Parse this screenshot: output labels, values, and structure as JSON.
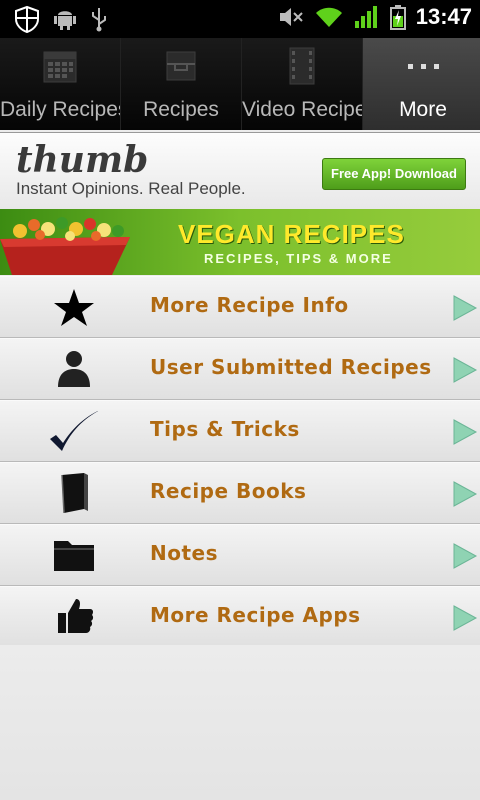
{
  "status_bar": {
    "time": "13:47",
    "icons": [
      "shield-icon",
      "android-icon",
      "usb-icon",
      "mute-icon",
      "wifi-icon",
      "signal-icon",
      "battery-charging-icon"
    ]
  },
  "tabs": [
    {
      "label": "Daily Recipes",
      "icon": "calendar-icon",
      "active": false
    },
    {
      "label": "Recipes",
      "icon": "recipe-box-icon",
      "active": false
    },
    {
      "label": "Video Recipe",
      "icon": "film-icon",
      "active": false
    },
    {
      "label": "More",
      "icon": "more-dots-icon",
      "active": true
    }
  ],
  "ad": {
    "logo": "thumb",
    "tagline": "Instant Opinions. Real People.",
    "button": "Free App! Download"
  },
  "banner": {
    "title": "VEGAN RECIPES",
    "subtitle": "RECIPES, TIPS & MORE"
  },
  "menu": [
    {
      "label": "More Recipe Info",
      "icon": "star-icon"
    },
    {
      "label": "User Submitted Recipes",
      "icon": "person-icon"
    },
    {
      "label": "Tips & Tricks",
      "icon": "checkmark-icon"
    },
    {
      "label": "Recipe Books",
      "icon": "book-icon"
    },
    {
      "label": "Notes",
      "icon": "folder-icon"
    },
    {
      "label": "More Recipe Apps",
      "icon": "thumbs-up-icon"
    }
  ],
  "colors": {
    "menu_text": "#b06a12",
    "arrow": "#8fd3b3",
    "active_tab": "#3c3c3c"
  }
}
